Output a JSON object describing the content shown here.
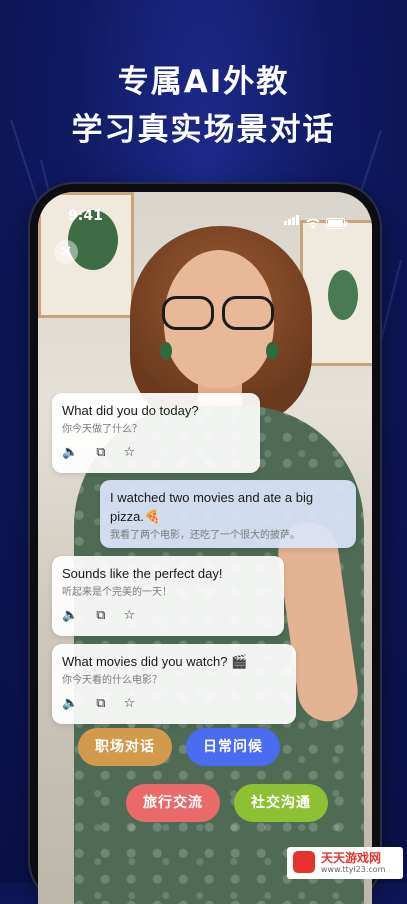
{
  "headline": {
    "line1": "专属AI外教",
    "line2": "学习真实场景对话"
  },
  "status": {
    "time": "9:41"
  },
  "close_glyph": "✕",
  "messages": [
    {
      "role": "ai",
      "en": "What did you do today?",
      "zh": "你今天做了什么？"
    },
    {
      "role": "user",
      "en": "I watched two movies and ate a big pizza.🍕",
      "zh": "我看了两个电影，还吃了一个很大的披萨。"
    },
    {
      "role": "ai",
      "en": "Sounds like the perfect day!",
      "zh": "听起来是个完美的一天！"
    },
    {
      "role": "ai",
      "en": "What movies did you watch? 🎬",
      "zh": "你今天看的什么电影？"
    }
  ],
  "tools": {
    "speaker": "🔈",
    "copy": "⧉",
    "star": "☆"
  },
  "topics": [
    {
      "label": "职场对话",
      "color": "#d39a4e"
    },
    {
      "label": "日常问候",
      "color": "#4a6cf0"
    },
    {
      "label": "旅行交流",
      "color": "#ea6a6a"
    },
    {
      "label": "社交沟通",
      "color": "#8dc032"
    }
  ],
  "watermark": {
    "title": "天天游戏网",
    "url": "www.ttyl23.com"
  }
}
